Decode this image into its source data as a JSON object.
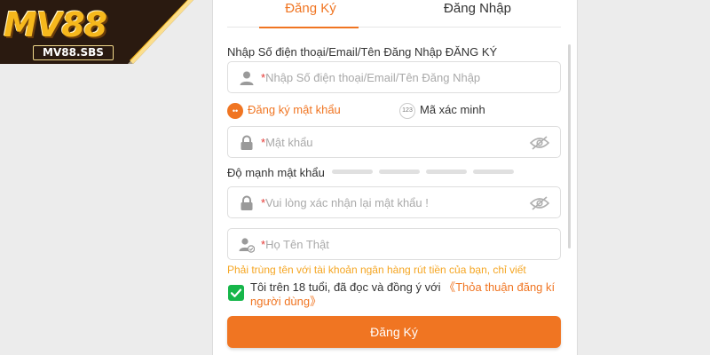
{
  "brand": {
    "logo_text": "MV88",
    "domain": "MV88.SBS"
  },
  "tabs": [
    {
      "label": "Đăng Ký",
      "active": true
    },
    {
      "label": "Đăng Nhập",
      "active": false
    }
  ],
  "form": {
    "account_label": "Nhập Số điện thoại/Email/Tên Đăng Nhập ĐĂNG KÝ",
    "account_placeholder": "Nhập Số điện thoại/Email/Tên Đăng Nhập",
    "options": {
      "password_label": "Đăng ký mật khẩu",
      "password_dot": "••",
      "code_label": "Mã xác minh",
      "code_badge": "123"
    },
    "password_placeholder": "Mật khẩu",
    "strength_label": "Độ mạnh mật khẩu",
    "strength_level": 0,
    "strength_segments": 4,
    "confirm_placeholder": "Vui lòng xác nhận lại mật khẩu !",
    "realname_placeholder": "Họ Tên Thật",
    "required_mark": "*",
    "realname_hint": "Phải trùng tên với tài khoản ngân hàng rút tiền của bạn, chỉ viết",
    "agree_checked": true,
    "agree_text": "Tôi trên 18 tuổi, đã đọc và đồng ý với ",
    "agree_link": "《Thỏa thuận đăng kí người dùng》",
    "submit_label": "Đăng Ký"
  },
  "colors": {
    "accent": "#f07522",
    "checkbox": "#16b64a",
    "warning": "#f5a623",
    "required": "#e53935",
    "logo_gold": "#f6b81c",
    "logo_bg": "#2a1a10"
  }
}
